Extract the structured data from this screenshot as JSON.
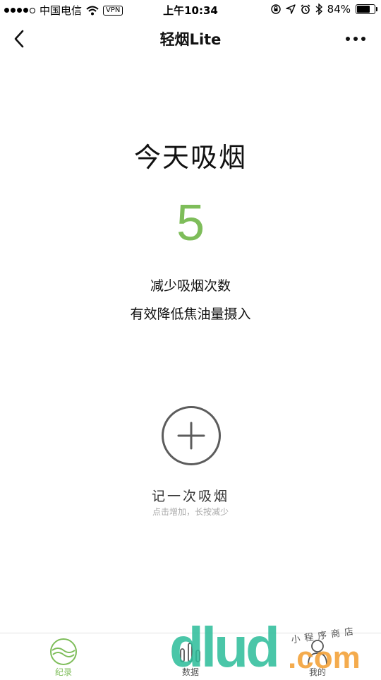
{
  "status_bar": {
    "carrier": "中国电信",
    "vpn_label": "VPN",
    "time": "上午10:34",
    "battery": "84%",
    "battery_level": 0.84
  },
  "nav": {
    "title": "轻烟Lite"
  },
  "main": {
    "heading": "今天吸烟",
    "count": "5",
    "tip_line1": "减少吸烟次数",
    "tip_line2": "有效降低焦油量摄入",
    "add_label": "记一次吸烟",
    "add_hint": "点击增加，长按减少"
  },
  "tabs": [
    {
      "label": "纪录",
      "icon": "wave-circle-icon",
      "active": true
    },
    {
      "label": "数据",
      "icon": "bar-chart-icon",
      "active": false
    },
    {
      "label": "我的",
      "icon": "person-icon",
      "active": false
    }
  ],
  "watermark": {
    "brand": "dlud",
    "suffix": ".com",
    "caption": "小程序商店"
  },
  "colors": {
    "accent": "#7ebd5a",
    "text": "#111111",
    "hint": "#aaaaaa",
    "button_border": "#5c5c5c"
  }
}
